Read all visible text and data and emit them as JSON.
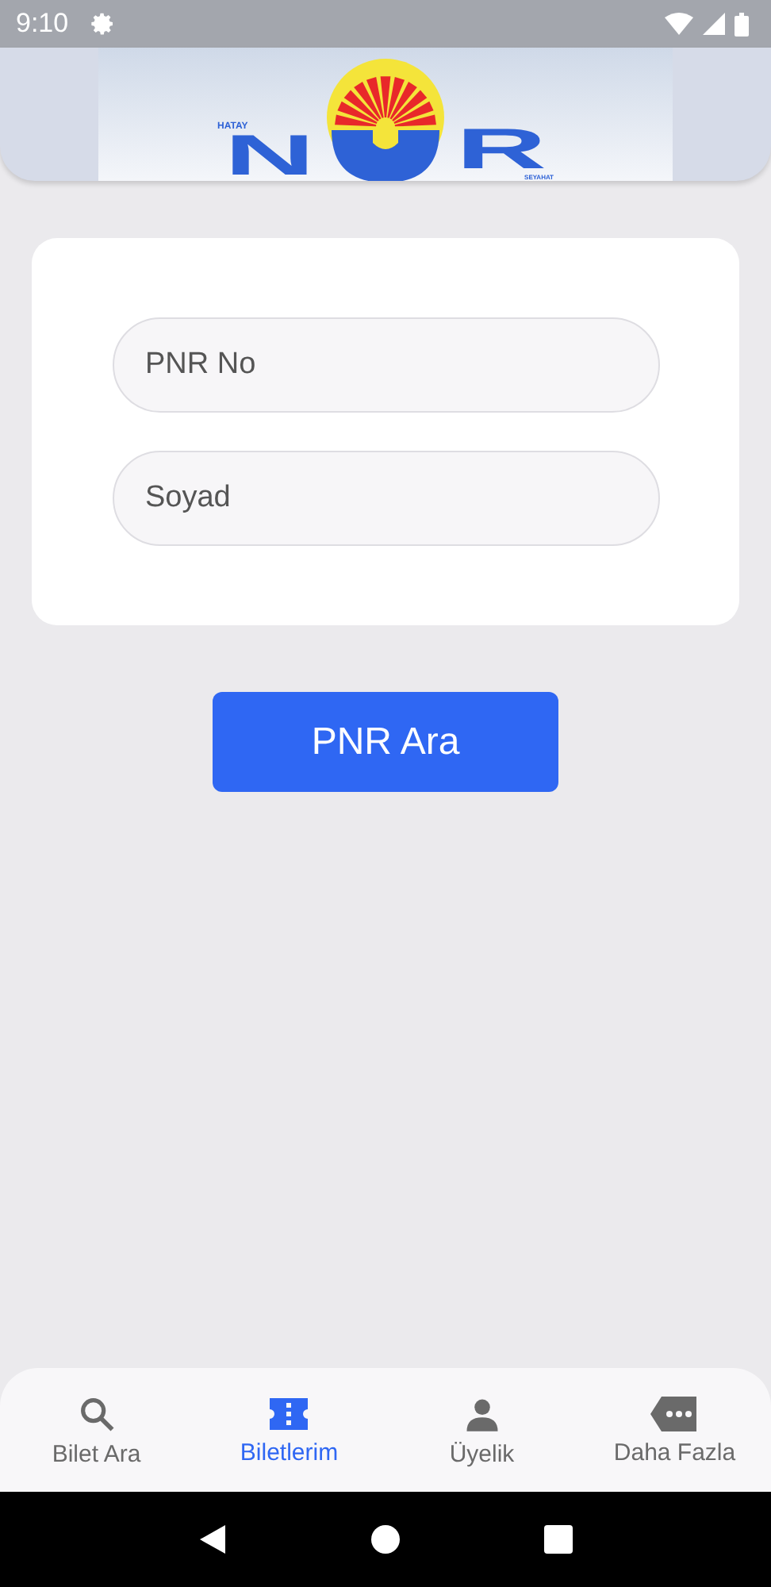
{
  "status_bar": {
    "time": "9:10"
  },
  "logo": {
    "top": "HATAY",
    "left": "N",
    "right": "R",
    "bottom": "SEYAHAT"
  },
  "form": {
    "fields": [
      {
        "placeholder": "PNR No"
      },
      {
        "placeholder": "Soyad"
      }
    ]
  },
  "search_button": "PNR Ara",
  "tabs": [
    {
      "label": "Bilet Ara",
      "kind": "search",
      "selected": false
    },
    {
      "label": "Biletlerim",
      "kind": "ticket",
      "selected": true
    },
    {
      "label": "Üyelik",
      "kind": "person",
      "selected": false
    },
    {
      "label": "Daha Fazla",
      "kind": "more",
      "selected": false
    }
  ]
}
